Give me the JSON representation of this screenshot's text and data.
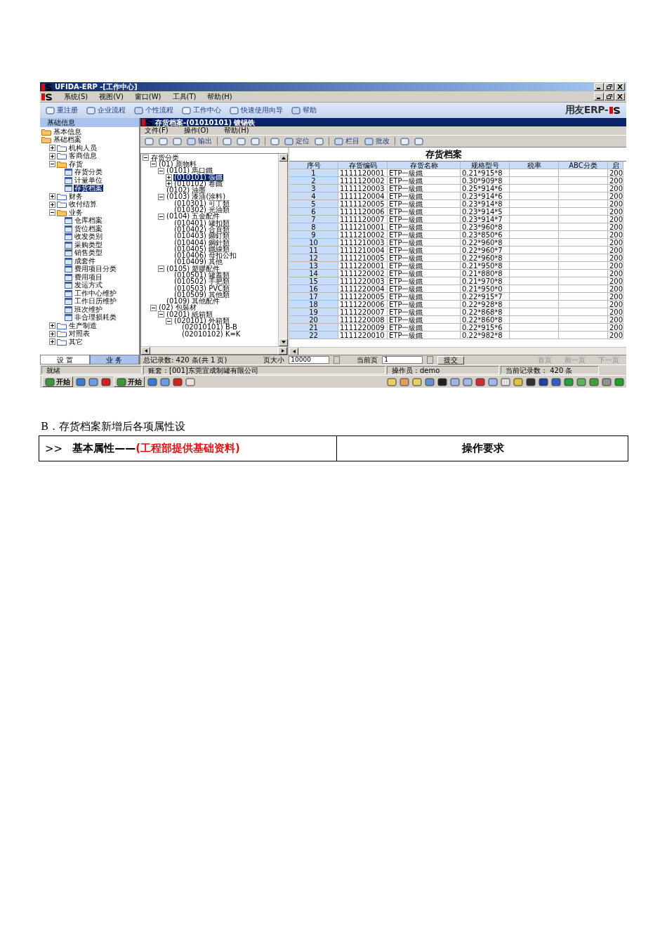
{
  "window": {
    "title": "UFIDA-ERP -[工作中心]"
  },
  "menu": [
    "系统(S)",
    "视图(V)",
    "窗口(W)",
    "工具(T)",
    "帮助(H)"
  ],
  "toolbar": [
    "重注册",
    "企业流程",
    "个性流程",
    "工作中心",
    "快速使用向导",
    "帮助"
  ],
  "logo": "用友ERP-",
  "sidebar": {
    "header": "基础信息",
    "tree": [
      {
        "label": "基本信息",
        "kind": "folder",
        "selected": false
      },
      {
        "label": "基础档案",
        "kind": "folder",
        "selected": false,
        "children": [
          {
            "label": "机构人员",
            "kind": "folder",
            "expanded": false,
            "selected": false
          },
          {
            "label": "客商信息",
            "kind": "folder",
            "expanded": false,
            "selected": false
          },
          {
            "label": "存货",
            "kind": "folder",
            "expanded": true,
            "selected": false,
            "children": [
              {
                "label": "存货分类",
                "kind": "doc",
                "selected": false
              },
              {
                "label": "计量单位",
                "kind": "doc",
                "selected": false
              },
              {
                "label": "存货档案",
                "kind": "doc",
                "selected": true
              }
            ]
          },
          {
            "label": "财务",
            "kind": "folder",
            "expanded": false,
            "selected": false
          },
          {
            "label": "收付结算",
            "kind": "folder",
            "expanded": false,
            "selected": false
          },
          {
            "label": "业务",
            "kind": "folder",
            "expanded": true,
            "selected": false,
            "children": [
              {
                "label": "仓库档案",
                "kind": "doc",
                "selected": false
              },
              {
                "label": "货位档案",
                "kind": "doc",
                "selected": false
              },
              {
                "label": "收发类别",
                "kind": "doc",
                "selected": false
              },
              {
                "label": "采购类型",
                "kind": "doc",
                "selected": false
              },
              {
                "label": "销售类型",
                "kind": "doc",
                "selected": false
              },
              {
                "label": "成套件",
                "kind": "doc",
                "selected": false
              },
              {
                "label": "费用项目分类",
                "kind": "doc",
                "selected": false
              },
              {
                "label": "费用项目",
                "kind": "doc",
                "selected": false
              },
              {
                "label": "发运方式",
                "kind": "doc",
                "selected": false
              },
              {
                "label": "工作中心维护",
                "kind": "doc",
                "selected": false
              },
              {
                "label": "工作日历维护",
                "kind": "doc",
                "selected": false
              },
              {
                "label": "班次维护",
                "kind": "doc",
                "selected": false
              },
              {
                "label": "非合理损耗类",
                "kind": "doc",
                "selected": false
              }
            ]
          },
          {
            "label": "生产制造",
            "kind": "folder",
            "expanded": false,
            "selected": false
          },
          {
            "label": "对照表",
            "kind": "folder",
            "expanded": false,
            "selected": false
          },
          {
            "label": "其它",
            "kind": "folder",
            "expanded": false,
            "selected": false
          }
        ]
      }
    ],
    "tabs": [
      {
        "label": "设 置",
        "selected": true
      },
      {
        "label": "业 务",
        "selected": false
      }
    ]
  },
  "document_window": {
    "title": "存货档案-(01010101) 镀锡铁",
    "menu": [
      "文件(F)",
      "操作(O)",
      "帮助(H)"
    ],
    "toolbar": [
      "输出",
      "定位",
      "栏目",
      "批改"
    ],
    "heading": "存货档案",
    "category_tree": [
      {
        "label": "存货分类",
        "expanded": true,
        "selected": false,
        "children": [
          {
            "label": "(01) 原物料",
            "expanded": true,
            "selected": false,
            "children": [
              {
                "label": "(0101) 馬口鐵",
                "expanded": true,
                "selected": false,
                "children": [
                  {
                    "label": "(010101) 張鐵",
                    "expanded": false,
                    "selected": true
                  },
                  {
                    "label": "(010102) 卷鐵",
                    "expanded": false,
                    "selected": false
                  }
                ]
              },
              {
                "label": "(0102) 油墨",
                "selected": false
              },
              {
                "label": "(0103) 漆油(涂料)",
                "expanded": true,
                "selected": false,
                "children": [
                  {
                    "label": "(010301) 可丁類",
                    "selected": false
                  },
                  {
                    "label": "(010302) 光油類",
                    "selected": false
                  }
                ]
              },
              {
                "label": "(0104) 五金配件",
                "expanded": true,
                "selected": false,
                "children": [
                  {
                    "label": "(010401) 罐扣類",
                    "selected": false
                  },
                  {
                    "label": "(010402) 合頁類",
                    "selected": false
                  },
                  {
                    "label": "(010403) 鉚釘類",
                    "selected": false
                  },
                  {
                    "label": "(010404) 鋼針類",
                    "selected": false
                  },
                  {
                    "label": "(010405) 鐵線類",
                    "selected": false
                  },
                  {
                    "label": "(010406) 母扣公扣",
                    "selected": false
                  },
                  {
                    "label": "(010409) 其他",
                    "selected": false
                  }
                ]
              },
              {
                "label": "(0105) 塑膠配件",
                "expanded": true,
                "selected": false,
                "children": [
                  {
                    "label": "(010501) 罐蓋類",
                    "selected": false
                  },
                  {
                    "label": "(010502) 手把類",
                    "selected": false
                  },
                  {
                    "label": "(010503) PVC類",
                    "selected": false
                  },
                  {
                    "label": "(010509) 其他類",
                    "selected": false
                  }
                ]
              },
              {
                "label": "(0109) 其他配件",
                "selected": false
              }
            ]
          },
          {
            "label": "(02) 包裝材",
            "expanded": true,
            "selected": false,
            "children": [
              {
                "label": "(0201) 紙箱類",
                "expanded": true,
                "selected": false,
                "children": [
                  {
                    "label": "(020101) 外箱類",
                    "expanded": true,
                    "selected": false,
                    "children": [
                      {
                        "label": "(02010101) B-B",
                        "selected": false
                      },
                      {
                        "label": "(02010102) K=K",
                        "selected": false
                      }
                    ]
                  }
                ]
              }
            ]
          }
        ]
      }
    ],
    "table": {
      "columns": [
        "序号",
        "存货编码",
        "存货名称",
        "规格型号",
        "税率",
        "ABC分类",
        "启"
      ],
      "rows": [
        {
          "no": "1",
          "code": "1111120001",
          "name": "ETP一級鐵",
          "spec": "0.21*915*8",
          "column_7": "200"
        },
        {
          "no": "2",
          "code": "1111120002",
          "name": "ETP一級鐵",
          "spec": "0.30*909*8",
          "column_7": "200"
        },
        {
          "no": "3",
          "code": "1111120003",
          "name": "ETP一級鐵",
          "spec": "0.25*914*6",
          "column_7": "200"
        },
        {
          "no": "4",
          "code": "1111120004",
          "name": "ETP一級鐵",
          "spec": "0.23*914*6",
          "column_7": "200"
        },
        {
          "no": "5",
          "code": "1111120005",
          "name": "ETP一級鐵",
          "spec": "0.23*914*8",
          "column_7": "200"
        },
        {
          "no": "6",
          "code": "1111120006",
          "name": "ETP一級鐵",
          "spec": "0.23*914*5",
          "column_7": "200"
        },
        {
          "no": "7",
          "code": "1111120007",
          "name": "ETP一級鐵",
          "spec": "0.23*914*7",
          "column_7": "200"
        },
        {
          "no": "8",
          "code": "1111210001",
          "name": "ETP一級鐵",
          "spec": "0.23*960*8",
          "column_7": "200"
        },
        {
          "no": "9",
          "code": "1111210002",
          "name": "ETP一級鐵",
          "spec": "0.23*850*6",
          "column_7": "200"
        },
        {
          "no": "10",
          "code": "1111210003",
          "name": "ETP一級鐵",
          "spec": "0.22*960*8",
          "column_7": "200"
        },
        {
          "no": "11",
          "code": "1111210004",
          "name": "ETP一級鐵",
          "spec": "0.22*960*7",
          "column_7": "200"
        },
        {
          "no": "12",
          "code": "1111210005",
          "name": "ETP一級鐵",
          "spec": "0.22*960*8",
          "column_7": "200"
        },
        {
          "no": "13",
          "code": "1111220001",
          "name": "ETP一級鐵",
          "spec": "0.21*950*8",
          "column_7": "200"
        },
        {
          "no": "14",
          "code": "1111220002",
          "name": "ETP一級鐵",
          "spec": "0.21*880*8",
          "column_7": "200"
        },
        {
          "no": "15",
          "code": "1111220003",
          "name": "ETP一級鐵",
          "spec": "0.21*970*8",
          "column_7": "200"
        },
        {
          "no": "16",
          "code": "1111220004",
          "name": "ETP一級鐵",
          "spec": "0.21*950*0",
          "column_7": "200"
        },
        {
          "no": "17",
          "code": "1111220005",
          "name": "ETP一級鐵",
          "spec": "0.22*915*7",
          "column_7": "200"
        },
        {
          "no": "18",
          "code": "1111220006",
          "name": "ETP一級鐵",
          "spec": "0.22*928*8",
          "column_7": "200"
        },
        {
          "no": "19",
          "code": "1111220007",
          "name": "ETP一級鐵",
          "spec": "0.22*868*8",
          "column_7": "200"
        },
        {
          "no": "20",
          "code": "1111220008",
          "name": "ETP一級鐵",
          "spec": "0.22*860*8",
          "column_7": "200"
        },
        {
          "no": "21",
          "code": "1111220009",
          "name": "ETP一級鐵",
          "spec": "0.22*915*6",
          "column_7": "200"
        },
        {
          "no": "22",
          "code": "1111220010",
          "name": "ETP一級鐵",
          "spec": "0.22*982*8",
          "column_7": "200"
        }
      ]
    },
    "pager": {
      "total": "总记录数: 420 条(共 1 页)",
      "page_size_label": "页大小",
      "page_size": "10000",
      "current_label": "当前页",
      "current": "1",
      "submit": "提交",
      "nav": [
        {
          "label": "首页",
          "disabled": true
        },
        {
          "label": "前一页",
          "disabled": true
        },
        {
          "label": "下一页",
          "disabled": true
        }
      ]
    }
  },
  "status_bar": [
    "就绪",
    "账套：[001]东莞宜成制罐有限公司",
    "操作员：demo",
    "当前记录数： 420 条"
  ],
  "taskbar": {
    "start_buttons": [
      "开始",
      "开始"
    ]
  },
  "document": {
    "heading": "B．存货档案新增后各项属性设",
    "table_header": {
      "marker": ">>",
      "label": "基本属性——",
      "note": "(工程部提供基础资料)",
      "column_2": "操作要求"
    }
  }
}
